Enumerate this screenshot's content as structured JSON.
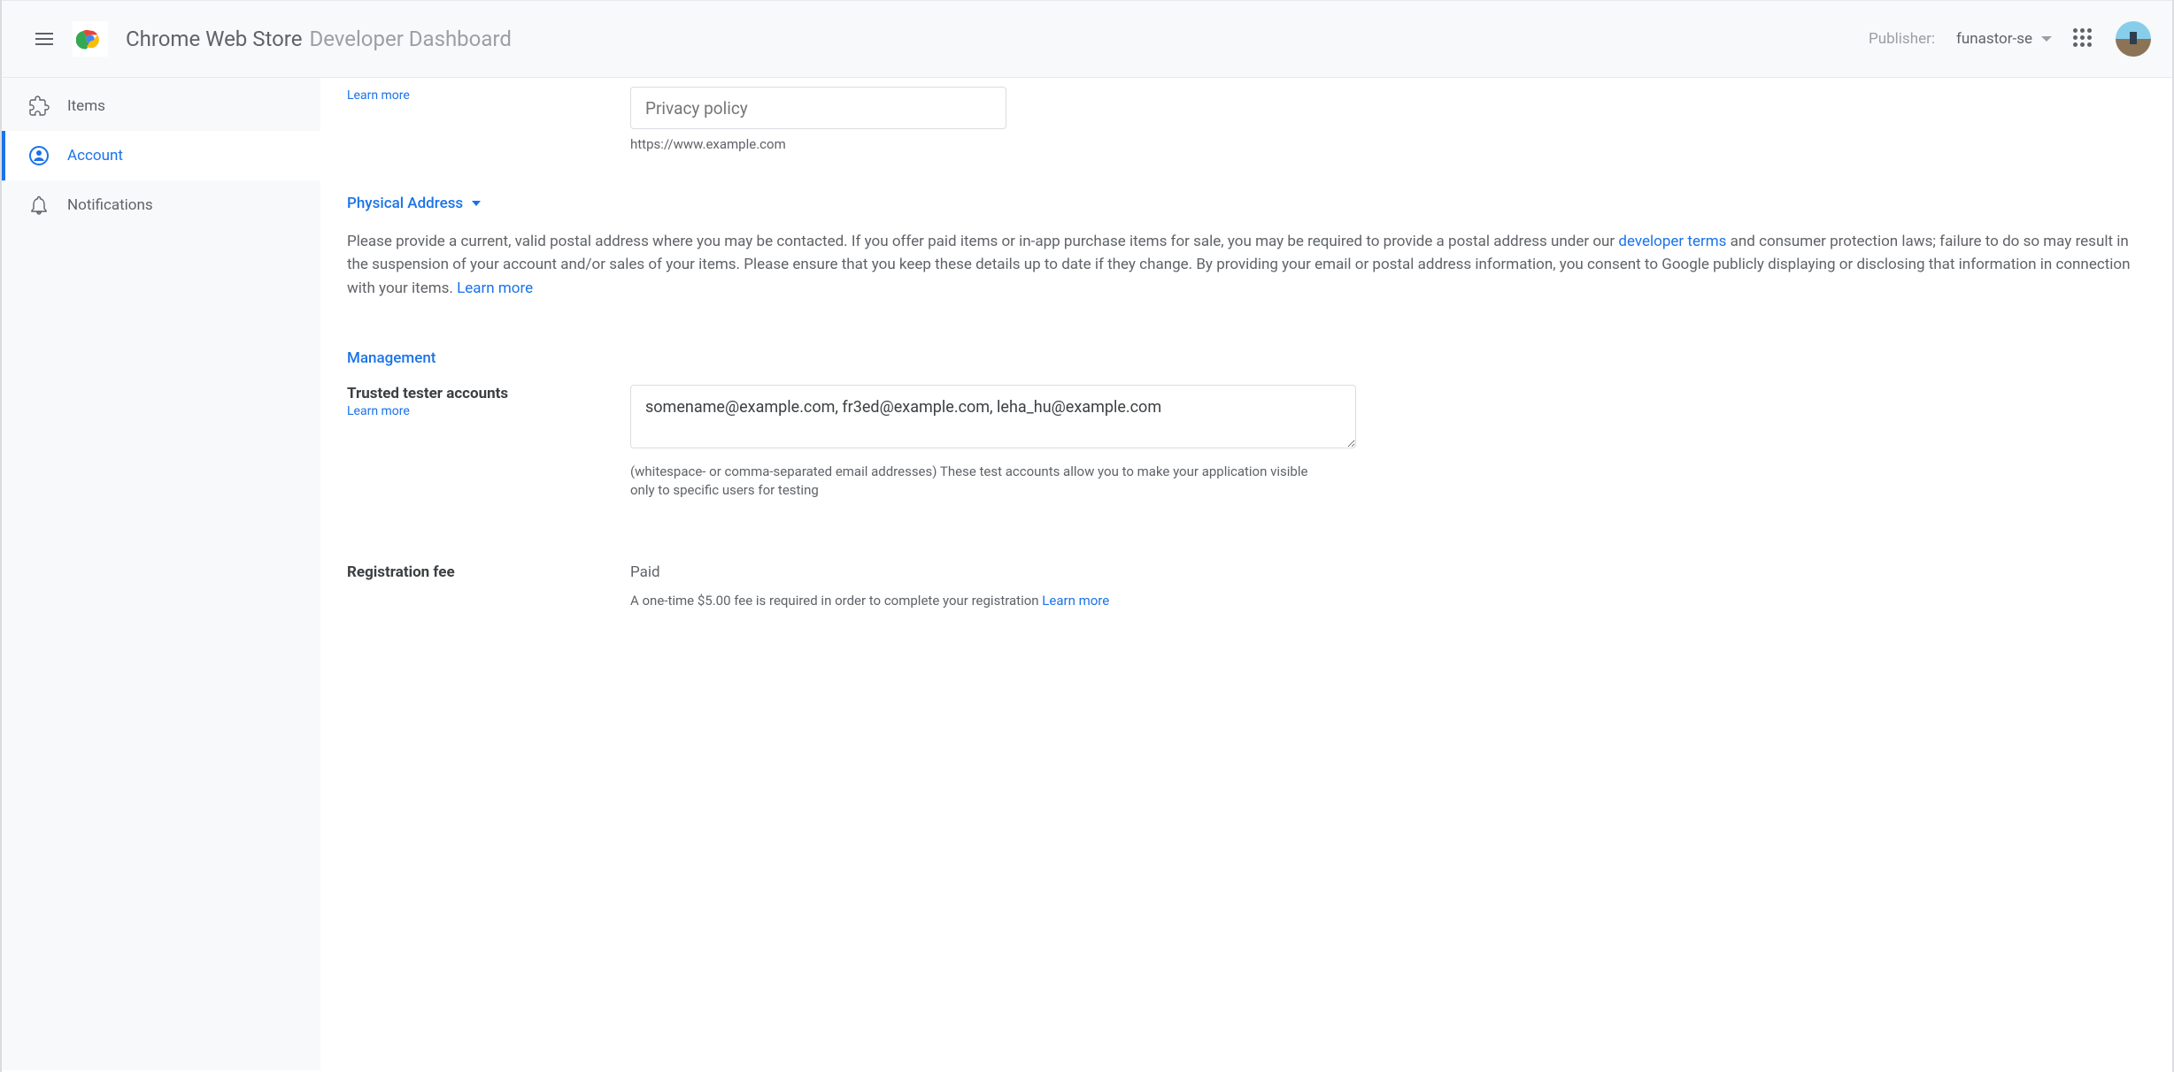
{
  "header": {
    "title_bold": "Chrome Web Store",
    "title_light": "Developer Dashboard",
    "publisher_label": "Publisher:",
    "publisher_value": "funastor-se"
  },
  "sidebar": {
    "items": [
      {
        "label": "Items"
      },
      {
        "label": "Account"
      },
      {
        "label": "Notifications"
      }
    ]
  },
  "privacy": {
    "learn_more": "Learn more",
    "placeholder": "Privacy policy",
    "helper": "https://www.example.com"
  },
  "physical_address": {
    "heading": "Physical Address",
    "body_1": "Please provide a current, valid postal address where you may be contacted. If you offer paid items or in-app purchase items for sale, you may be required to provide a postal address under our ",
    "dev_terms": "developer terms",
    "body_2": " and consumer protection laws; failure to do so may result in the suspension of your account and/or sales of your items. Please ensure that you keep these details up to date if they change. By providing your email or postal address information, you consent to Google publicly displaying or disclosing that information in connection with your items. ",
    "learn_more": "Learn more"
  },
  "management": {
    "heading": "Management",
    "trusted_label": "Trusted tester accounts",
    "trusted_learn_more": "Learn more",
    "trusted_value": "somename@example.com, fr3ed@example.com, leha_hu@example.com",
    "trusted_helper": "(whitespace- or comma-separated email addresses) These test accounts allow you to make your application visible only to specific users for testing",
    "reg_label": "Registration fee",
    "reg_status": "Paid",
    "reg_helper_text": "A one-time $5.00 fee is required in order to complete your registration ",
    "reg_learn_more": "Learn more"
  }
}
